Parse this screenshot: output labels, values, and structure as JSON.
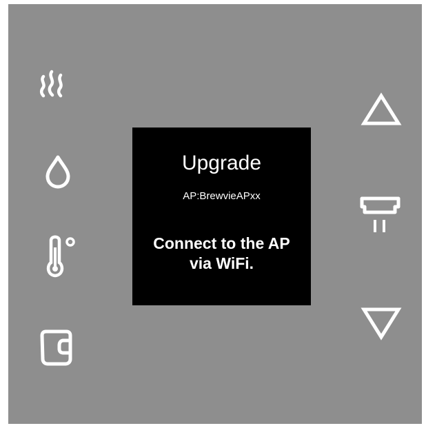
{
  "device": {
    "left_icons": [
      {
        "name": "steam-icon"
      },
      {
        "name": "water-drop-icon"
      },
      {
        "name": "thermometer-icon"
      },
      {
        "name": "cup-icon"
      }
    ],
    "right_buttons": [
      {
        "name": "up-arrow-icon"
      },
      {
        "name": "brew-head-icon"
      },
      {
        "name": "down-arrow-icon"
      }
    ],
    "colors": {
      "panel": "#8e8e8e",
      "icon": "#ffffff",
      "screen": "#000000"
    }
  },
  "screen": {
    "title": "Upgrade",
    "ap_label": "AP:BrewvieAPxx",
    "message_line1": "Connect to the AP",
    "message_line2": "via WiFi."
  }
}
